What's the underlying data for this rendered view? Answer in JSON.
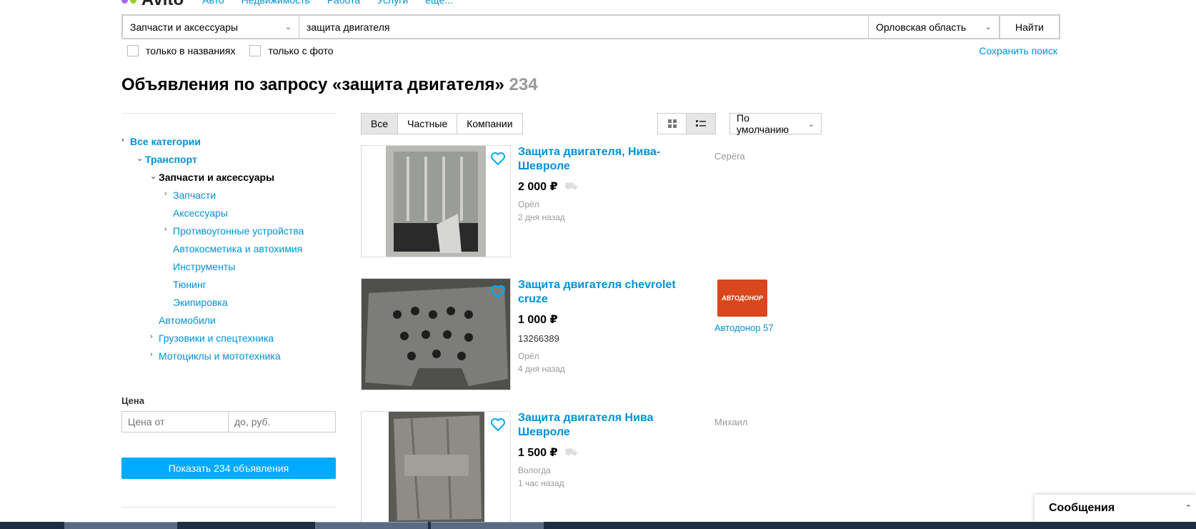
{
  "header": {
    "logo_text": "Avito",
    "nav": [
      "Авто",
      "Недвижимость",
      "Работа",
      "Услуги",
      "ещё..."
    ]
  },
  "search": {
    "category": "Запчасти и аксессуары",
    "query": "защита двигателя",
    "region": "Орловская область",
    "submit_label": "Найти",
    "only_titles_label": "только в названиях",
    "only_photo_label": "только с фото",
    "save_search_label": "Сохранить поиск"
  },
  "heading": {
    "text": "Объявления по запросу «защита двигателя»",
    "count": "234"
  },
  "sidebar": {
    "categories": [
      {
        "label": "Все категории"
      },
      {
        "label": "Транспорт"
      },
      {
        "label": "Запчасти и аксессуары"
      },
      {
        "label": "Запчасти"
      },
      {
        "label": "Аксессуары"
      },
      {
        "label": "Противоугонные устройства"
      },
      {
        "label": "Автокосметика и автохимия"
      },
      {
        "label": "Инструменты"
      },
      {
        "label": "Тюнинг"
      },
      {
        "label": "Экипировка"
      },
      {
        "label": "Автомобили"
      },
      {
        "label": "Грузовики и спецтехника"
      },
      {
        "label": "Мотоциклы и мототехника"
      }
    ],
    "price_label": "Цена",
    "price_from_placeholder": "Цена от",
    "price_to_placeholder": "до, руб.",
    "show_button": "Показать 234 объявления"
  },
  "toolbar": {
    "filters": [
      "Все",
      "Частные",
      "Компании"
    ],
    "sort": "По умолчанию"
  },
  "listings": [
    {
      "title": "Защита двигателя, Нива-Шевроле",
      "price": "2 000 ₽",
      "city": "Орёл",
      "date": "2 дня назад",
      "seller": "Серёга"
    },
    {
      "title": "Защита двигателя chevrolet cruze",
      "price": "1 000 ₽",
      "code": "13266389",
      "city": "Орёл",
      "date": "4 дня назад",
      "seller": "Автодонор 57",
      "seller_logo_text": "АВТОДОНОР"
    },
    {
      "title": "Защита двигателя Нива Шевроле",
      "price": "1 500 ₽",
      "city": "Вологда",
      "date": "1 час назад",
      "seller": "Михаил"
    }
  ],
  "messages_label": "Сообщения",
  "colors": {
    "accent": "#0091d9",
    "button": "#00aaff"
  }
}
